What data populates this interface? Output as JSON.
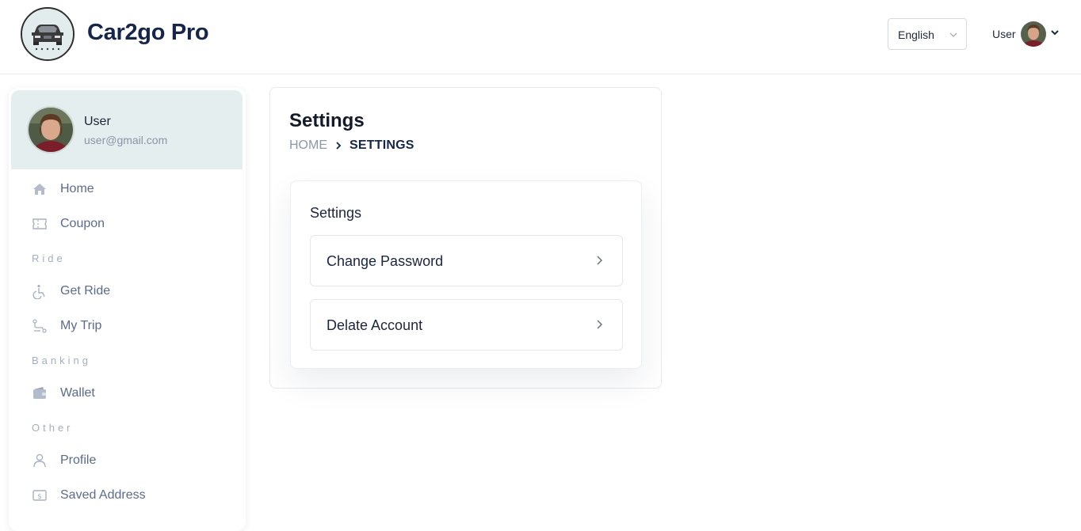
{
  "header": {
    "brand": "Car2go Pro",
    "language": "English",
    "user_label": "User"
  },
  "sidebar": {
    "profile": {
      "name": "User",
      "email": "user@gmail.com"
    },
    "items": [
      {
        "label": "Home",
        "icon": "home-icon"
      },
      {
        "label": "Coupon",
        "icon": "coupon-icon"
      },
      {
        "label": "Get Ride",
        "icon": "wheelchair-icon"
      },
      {
        "label": "My Trip",
        "icon": "route-icon"
      },
      {
        "label": "Wallet",
        "icon": "wallet-icon"
      },
      {
        "label": "Profile",
        "icon": "user-icon"
      },
      {
        "label": "Saved Address",
        "icon": "dollar-tag-icon"
      }
    ],
    "sections": [
      "Ride",
      "Banking",
      "Other"
    ]
  },
  "main": {
    "title": "Settings",
    "breadcrumb": {
      "home": "HOME",
      "current": "SETTINGS"
    },
    "panel": {
      "title": "Settings",
      "rows": [
        {
          "label": "Change Password"
        },
        {
          "label": "Delate Account"
        }
      ]
    }
  },
  "colors": {
    "brand": "#16254a",
    "profile_bg": "#e5eeef",
    "nav_text": "#5b6b8c",
    "section_text": "#a5aebf"
  }
}
